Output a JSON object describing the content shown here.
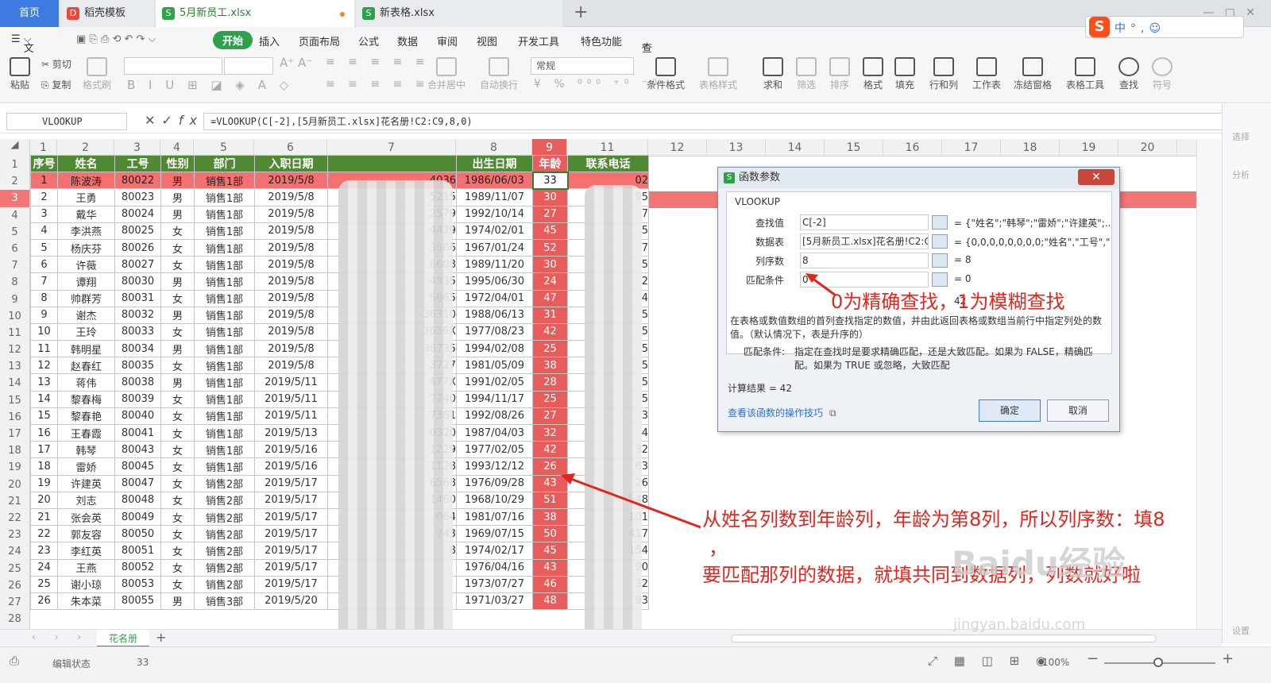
{
  "tabs": {
    "home": "首页",
    "docer": "稻壳模板",
    "file1": "5月新员工.xlsx",
    "file2": "新表格.xlsx"
  },
  "menu": [
    "文件",
    "开始",
    "插入",
    "页面布局",
    "公式",
    "数据",
    "审阅",
    "视图",
    "开发工具",
    "特色功能",
    "查找"
  ],
  "ribbon": {
    "paste": "粘贴",
    "cut": "剪切",
    "copy": "复制",
    "format_painter": "格式刷",
    "merge": "合并居中",
    "wrap": "自动换行",
    "number_format": "常规",
    "cond_format": "条件格式",
    "table_style": "表格样式",
    "sum": "求和",
    "filter": "筛选",
    "sort": "排序",
    "format": "格式",
    "fill": "填充",
    "rowcol": "行和列",
    "sheet": "工作表",
    "freeze": "冻结窗格",
    "table_tools": "表格工具",
    "find": "查找",
    "symbol": "符号"
  },
  "ime": {
    "s": "S",
    "text": "中°,☺"
  },
  "formula_bar": {
    "name_box": "VLOOKUP",
    "formula": "=VLOOKUP(C[-2],[5月新员工.xlsx]花名册!C2:C9,8,0)"
  },
  "col_headers": [
    "1",
    "2",
    "3",
    "4",
    "5",
    "6",
    "7",
    "8",
    "9",
    "11",
    "12",
    "13",
    "14",
    "15",
    "16",
    "17",
    "18",
    "19",
    "20"
  ],
  "table": {
    "headers": [
      "序号",
      "姓名",
      "工号",
      "性别",
      "部门",
      "入职日期",
      "",
      "出生日期",
      "年龄",
      "联系电话"
    ],
    "rows": [
      [
        "1",
        "陈波涛",
        "80022",
        "男",
        "销售1部",
        "2019/5/8",
        "4036",
        "1986/06/03",
        "33",
        "02"
      ],
      [
        "2",
        "王勇",
        "80023",
        "男",
        "销售1部",
        "2019/5/8",
        "5215",
        "1989/11/07",
        "30",
        "95"
      ],
      [
        "3",
        "戴华",
        "80024",
        "男",
        "销售1部",
        "2019/5/8",
        "2579",
        "1992/10/14",
        "27",
        "7"
      ],
      [
        "4",
        "李洪燕",
        "80025",
        "女",
        "销售1部",
        "2019/5/8",
        "4429",
        "1974/02/01",
        "45",
        "5"
      ],
      [
        "5",
        "杨庆芬",
        "80026",
        "女",
        "销售1部",
        "2019/5/8",
        "3666",
        "1967/01/24",
        "52",
        "7"
      ],
      [
        "6",
        "许薇",
        "80027",
        "女",
        "销售1部",
        "2019/5/8",
        "6608",
        "1989/11/20",
        "30",
        "5"
      ],
      [
        "7",
        "谭翔",
        "80030",
        "男",
        "销售1部",
        "2019/5/8",
        "4935",
        "1995/06/30",
        "24",
        "2"
      ],
      [
        "8",
        "帅群芳",
        "80031",
        "女",
        "销售1部",
        "2019/5/8",
        "5065",
        "1972/04/01",
        "47",
        "4"
      ],
      [
        "9",
        "谢杰",
        "80032",
        "男",
        "销售1部",
        "2019/5/8",
        "36310",
        "1988/06/13",
        "31",
        "5"
      ],
      [
        "10",
        "王玲",
        "80033",
        "女",
        "销售1部",
        "2019/5/8",
        "3636X",
        "1977/08/23",
        "42",
        "5"
      ],
      [
        "11",
        "韩明星",
        "80034",
        "男",
        "销售1部",
        "2019/5/8",
        "38735",
        "1994/02/08",
        "25",
        "5"
      ],
      [
        "12",
        "赵春红",
        "80035",
        "女",
        "销售1部",
        "2019/5/8",
        "3727",
        "1981/05/09",
        "38",
        "5"
      ],
      [
        "13",
        "蒋伟",
        "80038",
        "男",
        "销售1部",
        "2019/5/11",
        "477X",
        "1991/02/05",
        "28",
        "5"
      ],
      [
        "14",
        "黎春梅",
        "80039",
        "女",
        "销售1部",
        "2019/5/11",
        "7740",
        "1994/11/17",
        "25",
        "5"
      ],
      [
        "15",
        "黎春艳",
        "80040",
        "女",
        "销售1部",
        "2019/5/11",
        "7381",
        "1992/08/26",
        "27",
        "3"
      ],
      [
        "16",
        "王春霞",
        "80041",
        "女",
        "销售1部",
        "2019/5/13",
        "0320",
        "1987/04/03",
        "32",
        "4"
      ],
      [
        "17",
        "韩琴",
        "80043",
        "女",
        "销售1部",
        "2019/5/16",
        "1229",
        "1977/02/05",
        "42",
        "32"
      ],
      [
        "18",
        "雷娇",
        "80045",
        "女",
        "销售1部",
        "2019/5/16",
        "1128",
        "1993/12/12",
        "26",
        "63"
      ],
      [
        "19",
        "许建英",
        "80047",
        "女",
        "销售2部",
        "2019/5/17",
        "6568",
        "1976/09/28",
        "43",
        "26"
      ],
      [
        "20",
        "刘志",
        "80048",
        "女",
        "销售2部",
        "2019/5/17",
        "1460",
        "1968/10/29",
        "51",
        "548"
      ],
      [
        "21",
        "张会英",
        "80049",
        "女",
        "销售2部",
        "2019/5/17",
        "064",
        "1981/07/16",
        "38",
        "101"
      ],
      [
        "22",
        "郭友容",
        "80050",
        "女",
        "销售2部",
        "2019/5/17",
        "743",
        "1969/07/15",
        "50",
        "417"
      ],
      [
        "23",
        "李红英",
        "80051",
        "女",
        "销售2部",
        "2019/5/17",
        "8",
        "1974/02/17",
        "45",
        "154"
      ],
      [
        "24",
        "王燕",
        "80052",
        "女",
        "销售2部",
        "2019/5/17",
        "",
        "1976/04/16",
        "43",
        "90"
      ],
      [
        "25",
        "谢小琼",
        "80053",
        "女",
        "销售2部",
        "2019/5/17",
        "",
        "1973/07/27",
        "46",
        "32"
      ],
      [
        "26",
        "朱本菜",
        "80055",
        "男",
        "销售3部",
        "2019/5/20",
        "",
        "1971/03/27",
        "48",
        "93"
      ]
    ]
  },
  "sheet_tab": "花名册",
  "status": {
    "mode": "编辑状态",
    "value": "33",
    "zoom": "100%"
  },
  "side_panel": {
    "select": "选择",
    "analysis": "分析",
    "settings": "设置"
  },
  "dialog": {
    "title": "函数参数",
    "func": "VLOOKUP",
    "fields": [
      {
        "label": "查找值",
        "value": "C[-2]",
        "result": "= {\"姓名\";\"韩琴\";\"雷娇\";\"许建英\";..."
      },
      {
        "label": "数据表",
        "value": "[5月新员工.xlsx]花名册!C2:C9",
        "result": "= {0,0,0,0,0,0,0,0;\"姓名\",\"工号\",\"..."
      },
      {
        "label": "列序数",
        "value": "8",
        "result": "= 8"
      },
      {
        "label": "匹配条件",
        "value": "0",
        "result": "= 0"
      }
    ],
    "result_hint": "42",
    "desc": "在表格或数值数组的首列查找指定的数值，并由此返回表格或数组当前行中指定列处的数值。（默认情况下，表是升序的）",
    "param_label": "匹配条件:",
    "param_desc": "指定在查找时是要求精确匹配，还是大致匹配。如果为 FALSE，精确匹配。如果为 TRUE 或忽略，大致匹配",
    "calc_result": "计算结果 = 42",
    "help_link": "查看该函数的操作技巧",
    "ok": "确定",
    "cancel": "取消",
    "close": "✕"
  },
  "annotations": {
    "a1": "0为精确查找，1为模糊查找",
    "a2": "从姓名列数到年龄列，年龄为第8列，所以列序数：填8",
    "a3": "，",
    "a4": "要匹配那列的数据，就填共同到数据列，列数就好啦"
  },
  "watermark": {
    "main": "Baidu经验",
    "url": "jingyan.baidu.com"
  },
  "colors": {
    "header_green": "#4f8a32",
    "age_red": "#e85c5c",
    "annotation_red": "#e5251c",
    "accent_blue": "#3d7be0"
  }
}
